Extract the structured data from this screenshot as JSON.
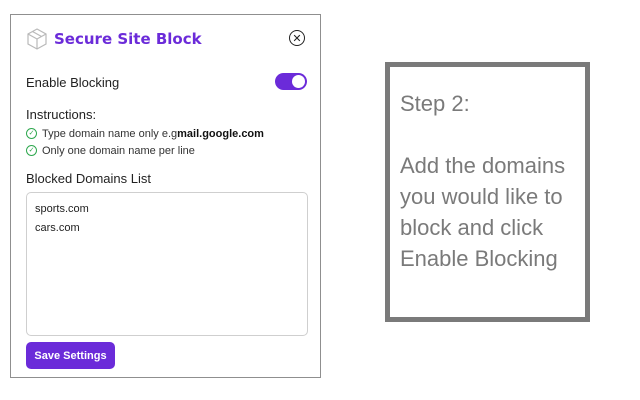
{
  "popup": {
    "title": "Secure Site Block",
    "close_icon": "close-icon",
    "logo_icon": "cube-icon",
    "toggle": {
      "label": "Enable Blocking",
      "enabled": true
    },
    "instructions": {
      "title": "Instructions:",
      "items": [
        {
          "prefix": "Type domain name only e.g ",
          "emphasis": "mail.google.com"
        },
        {
          "prefix": "Only one domain name per line",
          "emphasis": ""
        }
      ]
    },
    "list_label": "Blocked Domains List",
    "domains": [
      "sports.com",
      "cars.com"
    ],
    "save_label": "Save Settings"
  },
  "step": {
    "title": "Step 2:",
    "body": "Add the domains you would like to block and click Enable Blocking"
  },
  "colors": {
    "accent": "#6b2bd9",
    "check": "#2fa84f",
    "step_text": "#7a7a7a"
  }
}
